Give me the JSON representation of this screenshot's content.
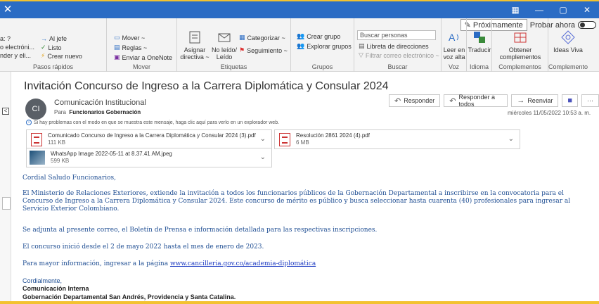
{
  "window": {
    "close_glyph": "✕",
    "controls": [
      "▦",
      "—",
      "▢",
      "✕"
    ]
  },
  "ribbon": {
    "proximamente": "Próximamente",
    "probar_ahora": "Probar ahora",
    "pasos_rapidos": {
      "label": "Pasos rápidos",
      "items": [
        "a: ?",
        "o electróni...",
        "nder y eli...",
        "Al jefe",
        "Listo",
        "Crear nuevo"
      ]
    },
    "mover": {
      "label": "Mover",
      "items": [
        "Mover ~",
        "Reglas ~",
        "Enviar a OneNote"
      ]
    },
    "etiquetas": {
      "label": "Etiquetas",
      "asignar": "Asignar directiva ~",
      "no_leido": "No leído/ Leído",
      "categorizar": "Categorizar ~",
      "seguimiento": "Seguimiento ~"
    },
    "grupos": {
      "label": "Grupos",
      "crear": "Crear grupo",
      "explorar": "Explorar grupos"
    },
    "buscar": {
      "label": "Buscar",
      "placeholder": "Buscar personas",
      "libreta": "Libreta de direcciones",
      "filtrar": "Filtrar correo electrónico ~"
    },
    "voz": {
      "label": "Voz",
      "leer": "Leer en voz alta"
    },
    "idioma": {
      "label": "Idioma",
      "traducir": "Traducir"
    },
    "complementos": {
      "label": "Complementos",
      "obtener": "Obtener complementos"
    },
    "complemento": {
      "label": "Complemento",
      "ideas": "Ideas Viva"
    }
  },
  "message": {
    "subject": "Invitación Concurso de Ingreso a la Carrera Diplomática y Consular 2024",
    "avatar": "CI",
    "sender": "Comunicación Institucional",
    "to_label": "Para",
    "to": "Funcionarios Gobernación",
    "date": "miércoles 11/05/2022 10:53 a. m.",
    "info": "Si hay problemas con el modo en que se muestra este mensaje, haga clic aquí para verlo en un explorador web.",
    "actions": {
      "responder": "Responder",
      "responder_todos": "Responder a todos",
      "reenviar": "Reenviar",
      "more": "···"
    },
    "attachments": [
      {
        "name": "Comunicado Concurso de Ingreso a la Carrera Diplomática y Consular 2024 (3).pdf",
        "size": "111 KB"
      },
      {
        "name": "Resolución 2861 2024 (4).pdf",
        "size": "6 MB"
      },
      {
        "name": "WhatsApp Image 2022-05-11 at 8.37.41 AM.jpeg",
        "size": "599 KB"
      }
    ],
    "body": {
      "greeting": "Cordial Saludo Funcionarios,",
      "p1": "El Ministerio de Relaciones Exteriores, extiende la invitación a todos los funcionarios públicos de la Gobernación Departamental a inscribirse en la convocatoria para el Concurso de Ingreso a la Carrera Diplomática y Consular 2024. Este concurso de mérito es público y busca seleccionar hasta cuarenta (40) profesionales para ingresar al Servicio Exterior Colombiano.",
      "p2": "Se adjunta al presente correo, el Boletín de Prensa e información detallada para las respectivas inscripciones.",
      "p3": "El concurso inició desde el 2 de mayo 2022 hasta el mes de enero de 2023.",
      "p4_prefix": "Para mayor información, ingresar a la página ",
      "p4_link": "www.cancilleria.gov.co/academia-diplomática",
      "closing": "Cordialmente,",
      "sig1": "Comunicación Interna",
      "sig2": "Gobernación Departamental San Andrés, Providencia y Santa Catalina."
    }
  }
}
